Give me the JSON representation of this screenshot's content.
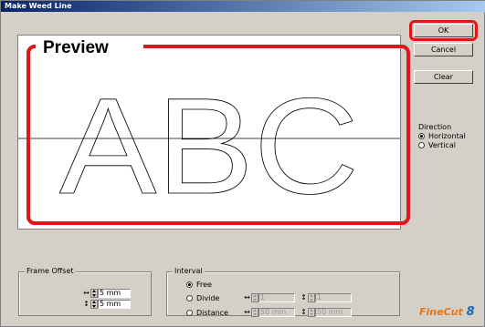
{
  "window": {
    "title": "Make Weed Line"
  },
  "preview": {
    "label": "Preview",
    "text": "ABC"
  },
  "buttons": {
    "ok": "OK",
    "cancel": "Cancel",
    "clear": "Clear"
  },
  "direction": {
    "label": "Direction",
    "options": [
      "Horizontal",
      "Vertical"
    ],
    "selected": "Horizontal"
  },
  "frame_offset": {
    "legend": "Frame Offset",
    "horizontal_value": "5 mm",
    "vertical_value": "5 mm"
  },
  "interval": {
    "legend": "Interval",
    "options": [
      "Free",
      "Divide",
      "Distance"
    ],
    "selected": "Free",
    "divide_h": "1",
    "divide_v": "1",
    "distance_h": "50 mm",
    "distance_v": "50 mm"
  },
  "logo": {
    "brand": "FineCut",
    "version": "8"
  },
  "colors": {
    "highlight": "#e0161b",
    "title_bar": "#0a246a",
    "dialog_bg": "#d4d0c8"
  }
}
